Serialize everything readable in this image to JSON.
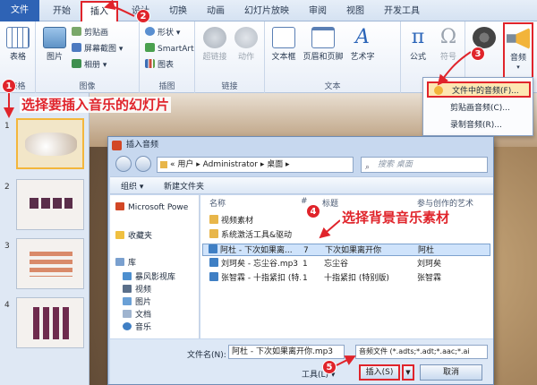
{
  "ribbon_tabs": [
    "文件",
    "开始",
    "插入",
    "设计",
    "切换",
    "动画",
    "幻灯片放映",
    "审阅",
    "视图",
    "开发工具"
  ],
  "groups": {
    "table": {
      "label": "表格",
      "items": {
        "table": "表格"
      }
    },
    "images": {
      "label": "图像",
      "items": {
        "picture": "图片",
        "clipart": "剪贴画",
        "screenshot": "屏幕截图",
        "album": "相册"
      }
    },
    "illustrations": {
      "label": "插图",
      "items": {
        "shapes": "形状",
        "smartart": "SmartArt",
        "chart": "图表"
      }
    },
    "links": {
      "label": "链接",
      "items": {
        "hyperlink": "超链接",
        "action": "动作"
      }
    },
    "text": {
      "label": "文本",
      "items": {
        "textbox": "文本框",
        "header_footer": "页眉和页脚",
        "wordart": "艺术字"
      }
    },
    "symbols": {
      "items": {
        "equation": "公式",
        "symbol": "符号"
      }
    },
    "media": {
      "items": {
        "audio": "音频"
      }
    }
  },
  "audio_menu": [
    "文件中的音频(F)...",
    "剪贴画音频(C)...",
    "录制音频(R)..."
  ],
  "slide_numbers": [
    "1",
    "2",
    "3",
    "4"
  ],
  "annotations": {
    "n1": "1",
    "n2": "2",
    "n3": "3",
    "n4": "4",
    "n5": "5",
    "note_select_slide": "选择要插入音乐的幻灯片",
    "note_select_music": "选择背景音乐素材"
  },
  "dialog": {
    "title": "插入音频",
    "address": "« 用户 ▸ Administrator ▸ 桌面 ▸",
    "search_placeholder": "搜索 桌面",
    "toolbar": {
      "organize": "组织 ▾",
      "new_folder": "新建文件夹"
    },
    "nav_items": [
      "Microsoft Powe",
      "收藏夹",
      "库",
      "暴风影视库",
      "视频",
      "图片",
      "文档",
      "音乐"
    ],
    "columns": {
      "name": "名称",
      "num": "#",
      "title": "标题",
      "artist": "参与创作的艺术"
    },
    "files": [
      {
        "name": "视频素材",
        "num": "",
        "title": "",
        "artist": ""
      },
      {
        "name": "系统激活工具&驱动",
        "num": "",
        "title": "",
        "artist": ""
      },
      {
        "name": "阿杜 - 下次如果离...",
        "num": "7",
        "title": "下次如果离开你",
        "artist": "阿杜"
      },
      {
        "name": "刘珂矣 - 忘尘谷.mp3",
        "num": "1",
        "title": "忘尘谷",
        "artist": "刘珂矣"
      },
      {
        "name": "张智霖 - 十指紧扣 (特...",
        "num": "1",
        "title": "十指紧扣 (特别版)",
        "artist": "张智霖"
      }
    ],
    "filename_label": "文件名(N):",
    "filename_value": "阿杜 - 下次如果离开你.mp3",
    "filetype": "音频文件 (*.adts;*.adt;*.aac;*.ai",
    "tools_label": "工具(L) ▾",
    "insert_button": "插入(S)",
    "cancel_button": "取消"
  },
  "colors": {
    "accent_red": "#e0242b",
    "file_tab": "#2e63b5"
  }
}
